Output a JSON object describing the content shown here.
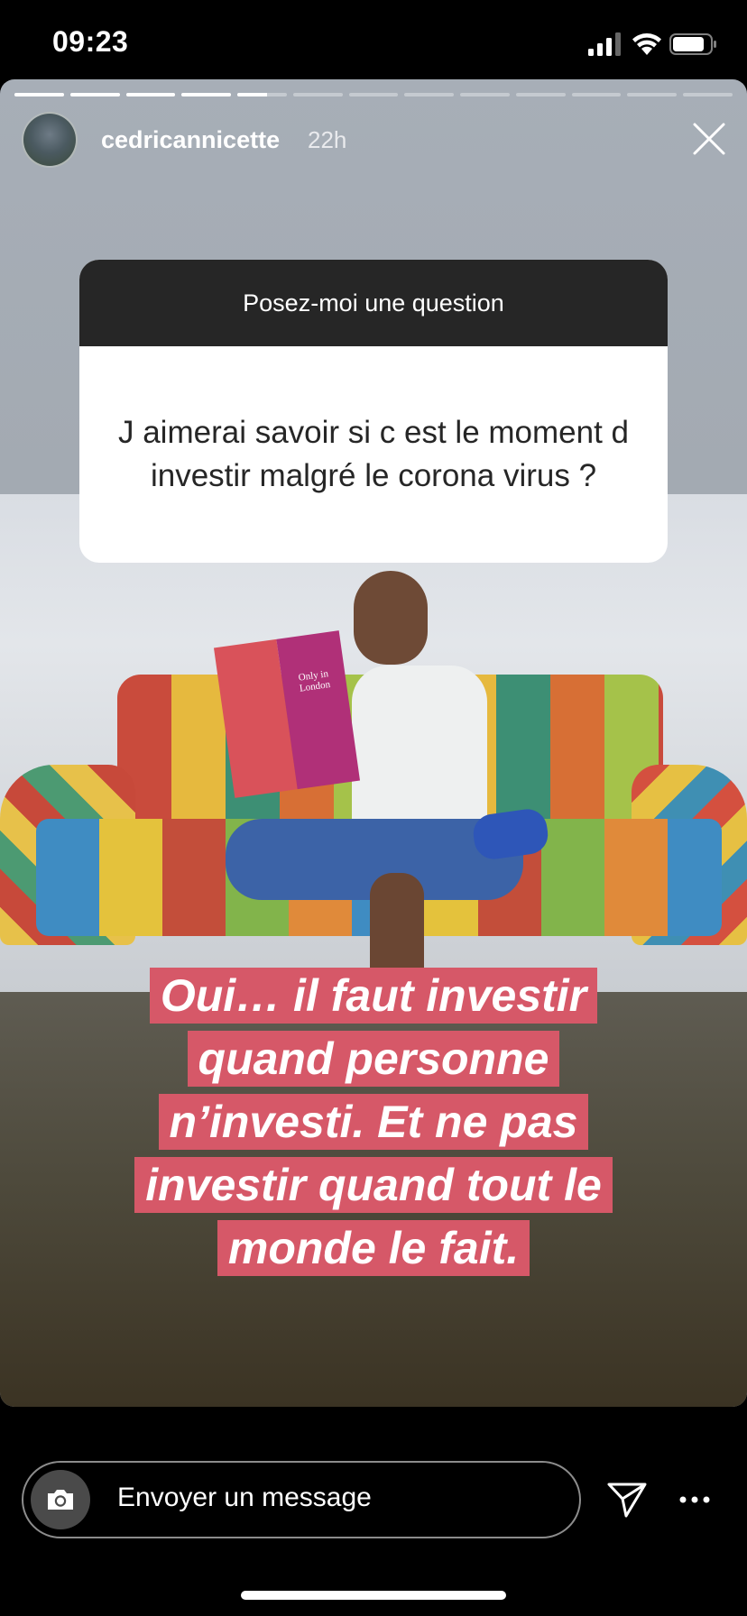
{
  "status_bar": {
    "time": "09:23"
  },
  "story": {
    "username": "cedricannicette",
    "age": "22h",
    "progress": {
      "segments": 13,
      "completed": 4,
      "current_fraction": 0.6
    },
    "question_sticker": {
      "header": "Posez-moi une question",
      "question": "J aimerai savoir si c est le moment d investir malgré le corona virus ?"
    },
    "book_title": "Only in London",
    "caption_lines": [
      "Oui… il faut investir",
      "quand personne",
      "n’investi. Et ne pas",
      "investir quand tout le",
      "monde le fait."
    ],
    "caption_color": "#d65868"
  },
  "bottom_bar": {
    "message_placeholder": "Envoyer un message",
    "icons": [
      "camera-icon",
      "send-icon",
      "more-icon"
    ]
  }
}
